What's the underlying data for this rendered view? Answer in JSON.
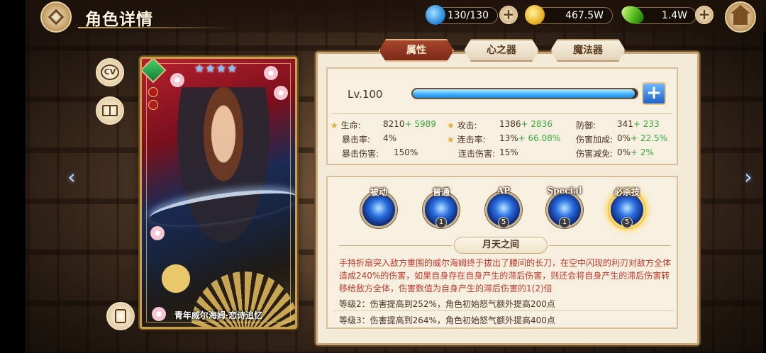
{
  "header": {
    "title": "角色详情",
    "stamina": "130/130",
    "gold": "467.5W",
    "gems": "1.4W"
  },
  "side_buttons": {
    "cv_label": "CV"
  },
  "card": {
    "stars": "★★★★",
    "name": "青年威尔海姆·恋诗追忆"
  },
  "tabs": [
    {
      "label": "属性",
      "active": true
    },
    {
      "label": "心之器",
      "active": false
    },
    {
      "label": "魔法器",
      "active": false
    }
  ],
  "level": {
    "label": "Lv.100",
    "exp_fraction": 0.99
  },
  "stats": {
    "hp": {
      "label": "生命:",
      "base": "8210",
      "bonus": "+ 5989"
    },
    "atk": {
      "label": "攻击:",
      "base": "1386",
      "bonus": "+ 2836"
    },
    "def": {
      "label": "防御:",
      "base": "341",
      "bonus": "+ 233"
    },
    "crit_rate": {
      "label": "暴击率:",
      "base": "4%"
    },
    "combo_rate": {
      "label": "连击率:",
      "base": "13%",
      "bonus": "+ 66.08%"
    },
    "dmg_bonus": {
      "label": "伤害加成:",
      "base": "0%",
      "bonus": "+ 22.5%"
    },
    "crit_dmg": {
      "label": "暴击伤害:",
      "base": "150%"
    },
    "combo_dmg": {
      "label": "连击伤害:",
      "base": "15%"
    },
    "dmg_reduce": {
      "label": "伤害减免:",
      "base": "0%",
      "bonus": "+ 2%"
    }
  },
  "skills": [
    {
      "label": "被动",
      "level": ""
    },
    {
      "label": "普通",
      "level": "1"
    },
    {
      "label": "AP",
      "level": "5"
    },
    {
      "label": "Special",
      "level": "1"
    },
    {
      "label": "必杀技",
      "level": "5"
    }
  ],
  "selected_skill": {
    "name": "月天之间",
    "description": "手持折扇突入敌方重围的威尔海姆终于拔出了腰间的长刀，在空中闪现的利刃对敌方全体造成240%的伤害，如果自身存在自身产生的滞后伤害，则还会将自身产生的滞后伤害转移给敌方全体，伤害数值为自身产生的滞后伤害的1(2)倍",
    "level2": "等级2：伤害提高到252%，角色初始怒气额外提高200点",
    "level3": "等级3：伤害提高到264%，角色初始怒气额外提高400点"
  },
  "colors": {
    "bonus_green": "#3aa63a",
    "desc_red": "#c0392b",
    "active_tab": "#a6442c"
  }
}
